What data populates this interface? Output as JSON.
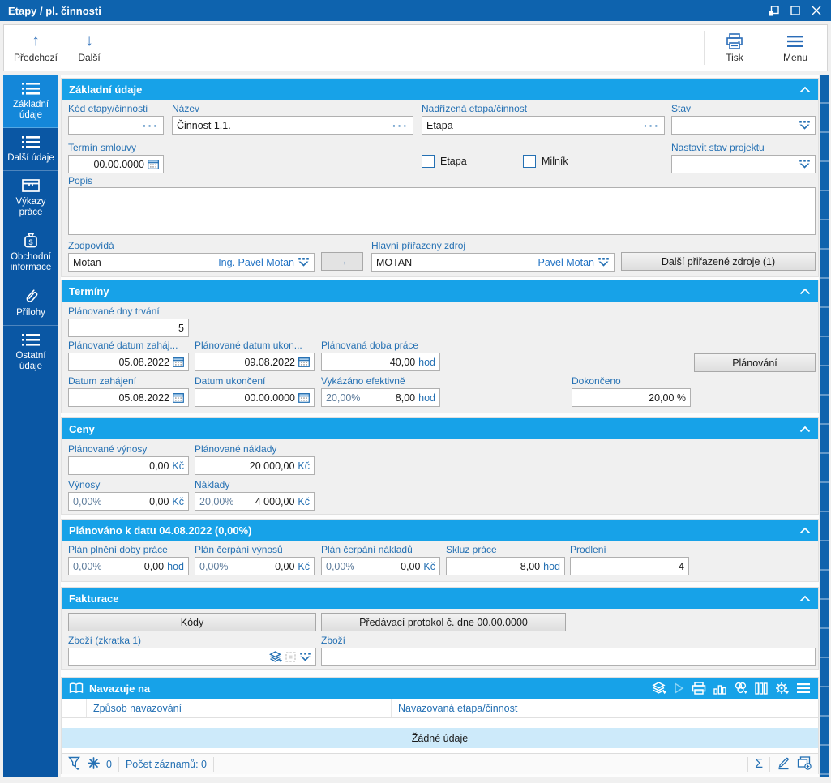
{
  "window": {
    "title": "Etapy / pl. činnosti"
  },
  "colors": {
    "titlebar": "#0e63ae",
    "sidebar": "#0a57a4",
    "sidebar_active": "#1487d9",
    "section_header": "#17a2e8",
    "label_blue": "#2470b3",
    "empty_row": "#cdeafa"
  },
  "icons": {
    "popup-window-icon": "square-with-corner-square",
    "maximize-icon": "square",
    "close-icon": "x",
    "prev-icon": "arrow-up",
    "next-icon": "arrow-down",
    "print-icon": "printer",
    "menu-icon": "hamburger",
    "dropdown-icon": "dots-over-chevron",
    "ellipsis-button": "three-dots",
    "calendar-icon": "calendar",
    "book-icon": "open-book",
    "layers-icon": "stacked-layers",
    "filter-icon": "funnel",
    "marked-icon": "asterisk",
    "sum-icon": "sigma",
    "edit-icon": "pencil",
    "copy-icon": "copy-plus",
    "gear-icon": "gear"
  },
  "toolbar": {
    "prev": "Předchozí",
    "next": "Další",
    "print": "Tisk",
    "menu": "Menu"
  },
  "sidebar": {
    "items": [
      {
        "label": "Základní údaje",
        "icon": "list-icon",
        "active": true
      },
      {
        "label": "Další údaje",
        "icon": "list-icon",
        "active": false
      },
      {
        "label": "Výkazy práce",
        "icon": "drawer-icon",
        "active": false
      },
      {
        "label": "Obchodní informace",
        "icon": "money-bag-icon",
        "active": false
      },
      {
        "label": "Přílohy",
        "icon": "paperclip-icon",
        "active": false
      },
      {
        "label": "Ostatní údaje",
        "icon": "list-icon",
        "active": false
      }
    ]
  },
  "basic": {
    "title": "Základní údaje",
    "kod_label": "Kód etapy/činnosti",
    "kod_value": "",
    "nazev_label": "Název",
    "nazev_value": "Činnost 1.1.",
    "nadrizena_label": "Nadřízená etapa/činnost",
    "nadrizena_value": "Etapa",
    "stav_label": "Stav",
    "stav_value": "",
    "termin_label": "Termín smlouvy",
    "termin_value": "00.00.0000",
    "etapa_checkbox": "Etapa",
    "milnik_checkbox": "Milník",
    "nastavit_label": "Nastavit stav projektu",
    "nastavit_value": "",
    "popis_label": "Popis",
    "popis_value": "",
    "zodpovida_label": "Zodpovídá",
    "zodpovida_value": "Motan",
    "zodpovida_person": "Ing. Pavel Motan",
    "zdroj_label": "Hlavní přiřazený zdroj",
    "zdroj_value": "MOTAN",
    "zdroj_person": "Pavel Motan",
    "dalsi_zdroje_button": "Další přiřazené zdroje (1)"
  },
  "terminy": {
    "title": "Termíny",
    "dny_label": "Plánované dny trvání",
    "dny_value": "5",
    "pdz_label": "Plánované datum zaháj...",
    "pdz_value": "05.08.2022",
    "pdu_label": "Plánované datum ukon...",
    "pdu_value": "09.08.2022",
    "pdp_label": "Plánovaná doba práce",
    "pdp_value": "40,00",
    "pdp_unit": "hod",
    "planovani_button": "Plánování",
    "dz_label": "Datum zahájení",
    "dz_value": "05.08.2022",
    "du_label": "Datum ukončení",
    "du_value": "00.00.0000",
    "ve_label": "Vykázáno efektivně",
    "ve_pct": "20,00%",
    "ve_value": "8,00",
    "ve_unit": "hod",
    "dok_label": "Dokončeno",
    "dok_value": "20,00 %"
  },
  "ceny": {
    "title": "Ceny",
    "pv_label": "Plánované výnosy",
    "pv_value": "0,00",
    "pv_unit": "Kč",
    "pn_label": "Plánované náklady",
    "pn_value": "20 000,00",
    "pn_unit": "Kč",
    "v_label": "Výnosy",
    "v_pct": "0,00%",
    "v_value": "0,00",
    "v_unit": "Kč",
    "n_label": "Náklady",
    "n_pct": "20,00%",
    "n_value": "4 000,00",
    "n_unit": "Kč"
  },
  "planovano": {
    "title": "Plánováno k datu 04.08.2022 (0,00%)",
    "ppdp_label": "Plán plnění doby práce",
    "ppdp_pct": "0,00%",
    "ppdp_value": "0,00",
    "ppdp_unit": "hod",
    "pcv_label": "Plán čerpání výnosů",
    "pcv_pct": "0,00%",
    "pcv_value": "0,00",
    "pcv_unit": "Kč",
    "pcn_label": "Plán čerpání nákladů",
    "pcn_pct": "0,00%",
    "pcn_value": "0,00",
    "pcn_unit": "Kč",
    "skluz_label": "Skluz práce",
    "skluz_value": "-8,00",
    "skluz_unit": "hod",
    "prodleni_label": "Prodlení",
    "prodleni_value": "-4"
  },
  "fakturace": {
    "title": "Fakturace",
    "kody_button": "Kódy",
    "protokol_button": "Předávací protokol č.  dne 00.00.0000",
    "zbozi1_label": "Zboží (zkratka 1)",
    "zbozi1_value": "",
    "zbozi2_label": "Zboží",
    "zbozi2_value": ""
  },
  "navazuje": {
    "title": "Navazuje na",
    "col1": "Způsob navazování",
    "col2": "Navazovaná etapa/činnost",
    "empty": "Žádné údaje",
    "filter_count": "0",
    "records": "Počet záznamů: 0"
  }
}
